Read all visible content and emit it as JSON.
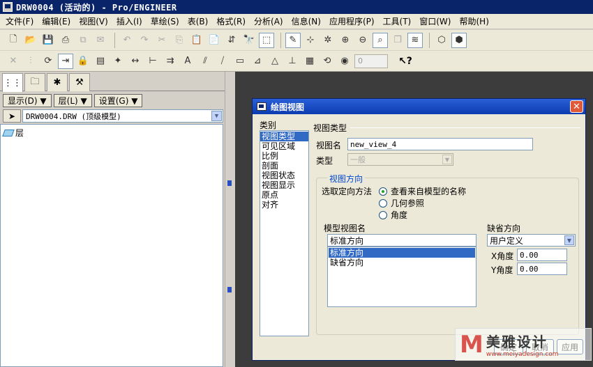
{
  "window": {
    "title": "DRW0004 (活动的) - Pro/ENGINEER"
  },
  "menu": [
    "文件(F)",
    "编辑(E)",
    "视图(V)",
    "插入(I)",
    "草绘(S)",
    "表(B)",
    "格式(R)",
    "分析(A)",
    "信息(N)",
    "应用程序(P)",
    "工具(T)",
    "窗口(W)",
    "帮助(H)"
  ],
  "toolbar": {
    "row1_icons": [
      "new-file-icon",
      "open-folder-icon",
      "save-icon",
      "print-icon",
      "copy-page-icon",
      "email-icon",
      "undo-icon",
      "redo-icon",
      "cut-icon",
      "copy-icon",
      "paste-icon",
      "paste-special-icon",
      "regenerate-icon",
      "find-icon",
      "select-box-icon",
      "redraw-icon",
      "spin-center-icon",
      "orient-icon",
      "zoom-in-icon",
      "zoom-out-icon",
      "refit-icon",
      "saved-views-icon",
      "layers-icon",
      "wireframe-icon",
      "hidden-line-icon"
    ],
    "row2_icons": [
      "delete-icon",
      "mirror-icon",
      "rotate-icon",
      "move-icon",
      "lock-icon",
      "table-icon",
      "highlight-icon",
      "dimension-icon",
      "align-icon",
      "snap-icon",
      "text-style-icon",
      "hatch-icon",
      "line-style-icon",
      "insert-icon",
      "weld-icon",
      "surface-finish-icon",
      "datum-icon",
      "table-grid-icon",
      "repeat-region-icon",
      "balloon-icon"
    ],
    "spinner_value": "0",
    "help_symbol": "↖?"
  },
  "left_panel": {
    "buttons": [
      "显示(D) ▼",
      "层(L) ▼",
      "设置(G) ▼"
    ],
    "model_name": "DRW0004.DRW (顶级模型)",
    "tree_items": [
      "层"
    ]
  },
  "dialog": {
    "title": "绘图视图",
    "category_label": "类别",
    "categories": [
      "视图类型",
      "可见区域",
      "比例",
      "剖面",
      "视图状态",
      "视图显示",
      "原点",
      "对齐"
    ],
    "section_title": "视图类型",
    "view_name_label": "视图名",
    "view_name_value": "new_view_4",
    "type_label": "类型",
    "type_value": "一般",
    "orientation_group_title": "视图方向",
    "orientation_method_label": "选取定向方法",
    "orientation_options": [
      "查看来自模型的名称",
      "几何参照",
      "角度"
    ],
    "selected_option_index": 0,
    "model_view_names_label": "模型视图名",
    "model_view_name_value": "标准方向",
    "model_view_list": [
      "标准方向",
      "缺省方向"
    ],
    "default_orientation_label": "缺省方向",
    "default_orientation_value": "用户定义",
    "x_angle_label": "X角度",
    "x_angle_value": "0.00",
    "y_angle_label": "Y角度",
    "y_angle_value": "0.00",
    "buttons": {
      "ok": "确定",
      "cancel": "取消",
      "apply": "应用"
    }
  },
  "watermark": {
    "logo": "M",
    "name": "美雅设计",
    "url": "www.meiyadesign.com"
  }
}
